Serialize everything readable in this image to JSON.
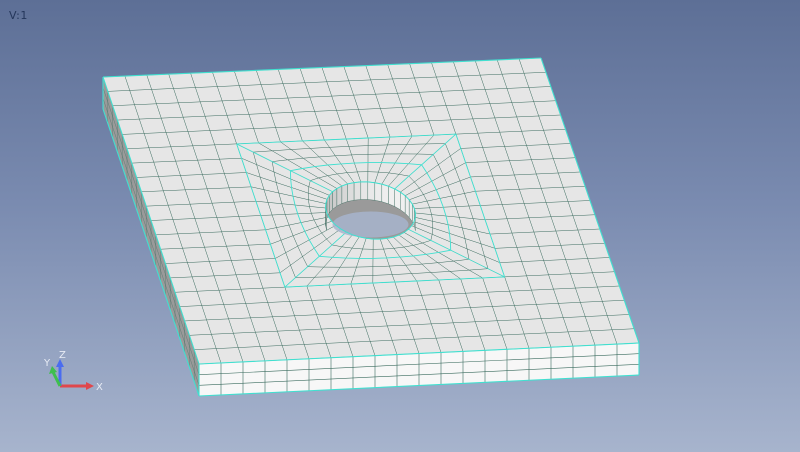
{
  "viewport": {
    "view_label": "V:1",
    "model": "plate-with-hole-hex-mesh"
  },
  "triad": {
    "x_label": "X",
    "y_label": "Y",
    "z_label": "Z"
  },
  "colors": {
    "background_top": "#5d6f96",
    "background_bottom": "#a7b4cd",
    "top_face": "#e6e6e6",
    "front_face": "#f7f7f7",
    "side_face": "#9a9a9a",
    "hole_wall": "#d9d9d9",
    "mesh_line": "#3a6b5e",
    "feature_edge": "#40e0d0",
    "x_axis": "#e0474c",
    "y_axis": "#3fbf4f",
    "z_axis": "#4a6cf0"
  }
}
